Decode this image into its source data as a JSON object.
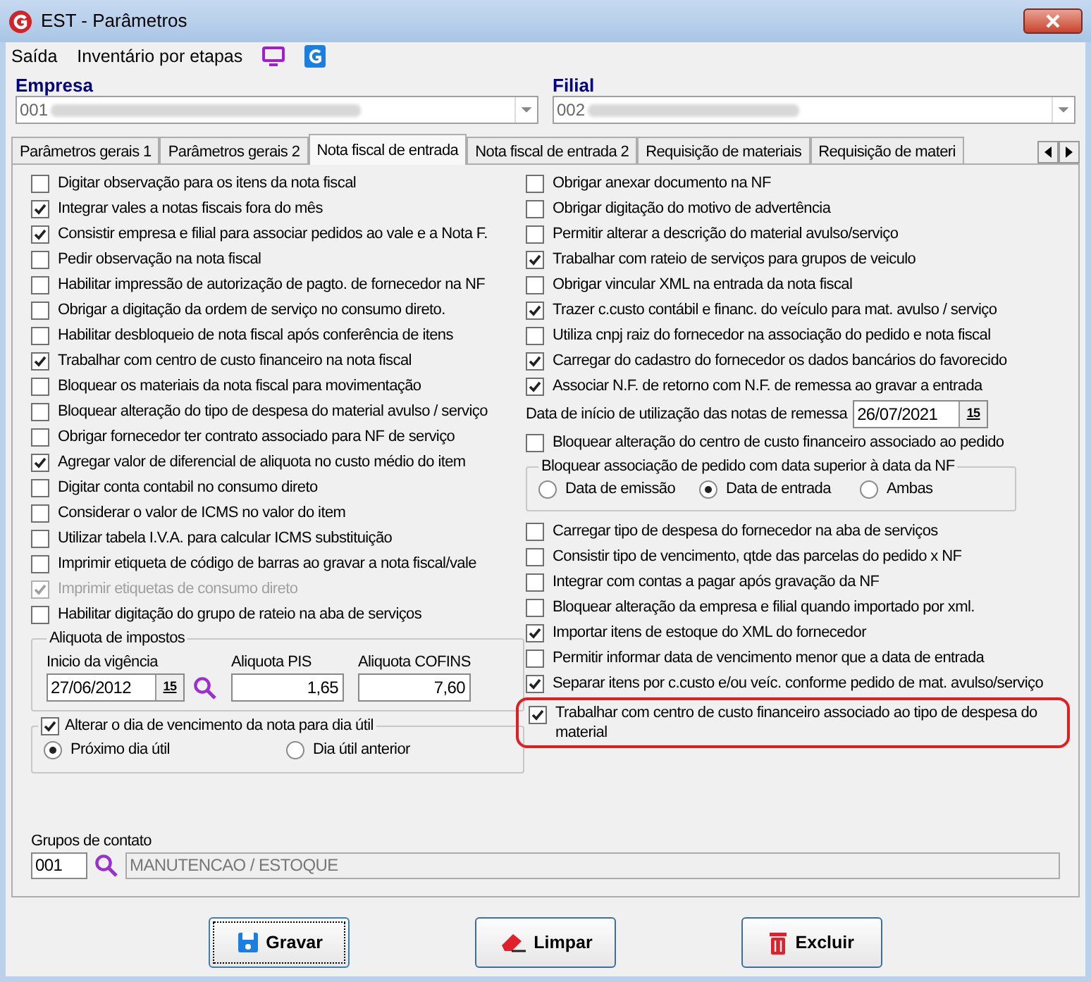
{
  "window": {
    "title": "EST - Parâmetros"
  },
  "menu": [
    "Saída",
    "Inventário por etapas"
  ],
  "empresa": {
    "label": "Empresa",
    "value": "001"
  },
  "filial": {
    "label": "Filial",
    "value": "002"
  },
  "tabs": [
    {
      "label": "Parâmetros gerais 1",
      "selected": false
    },
    {
      "label": "Parâmetros gerais 2",
      "selected": false
    },
    {
      "label": "Nota fiscal de entrada",
      "selected": true
    },
    {
      "label": "Nota fiscal de entrada 2",
      "selected": false
    },
    {
      "label": "Requisição de materiais",
      "selected": false
    },
    {
      "label": "Requisição de materi",
      "selected": false
    }
  ],
  "left_options": [
    {
      "label": "Digitar observação para os itens da nota fiscal",
      "checked": false,
      "disabled": false
    },
    {
      "label": "Integrar vales a notas fiscais fora do mês",
      "checked": true,
      "disabled": false
    },
    {
      "label": "Consistir empresa e filial para associar pedidos ao vale e a Nota F.",
      "checked": true,
      "disabled": false
    },
    {
      "label": "Pedir observação na nota fiscal",
      "checked": false,
      "disabled": false
    },
    {
      "label": "Habilitar impressão de autorização de pagto. de fornecedor na NF",
      "checked": false,
      "disabled": false
    },
    {
      "label": "Obrigar a digitação da ordem de serviço no consumo direto.",
      "checked": false,
      "disabled": false
    },
    {
      "label": "Habilitar desbloqueio de nota fiscal após conferência de itens",
      "checked": false,
      "disabled": false
    },
    {
      "label": "Trabalhar com centro de custo financeiro na nota fiscal",
      "checked": true,
      "disabled": false
    },
    {
      "label": "Bloquear os materiais da nota fiscal para movimentação",
      "checked": false,
      "disabled": false
    },
    {
      "label": "Bloquear alteração do tipo de despesa do material avulso / serviço",
      "checked": false,
      "disabled": false
    },
    {
      "label": "Obrigar fornecedor ter contrato associado para NF de serviço",
      "checked": false,
      "disabled": false
    },
    {
      "label": "Agregar valor de diferencial de aliquota no custo médio do item",
      "checked": true,
      "disabled": false
    },
    {
      "label": "Digitar conta contabil no consumo direto",
      "checked": false,
      "disabled": false
    },
    {
      "label": "Considerar o valor de ICMS no valor do item",
      "checked": false,
      "disabled": false
    },
    {
      "label": "Utilizar tabela I.V.A. para calcular ICMS substituição",
      "checked": false,
      "disabled": false
    },
    {
      "label": "Imprimir etiqueta de código de barras ao gravar a nota fiscal/vale",
      "checked": false,
      "disabled": false
    },
    {
      "label": "Imprimir etiquetas de consumo direto",
      "checked": true,
      "disabled": true
    },
    {
      "label": "Habilitar digitação do grupo de rateio na aba de serviços",
      "checked": false,
      "disabled": false
    }
  ],
  "aliquota": {
    "title": "Aliquota de impostos",
    "inicio_label": "Inicio da vigência",
    "inicio_value": "27/06/2012",
    "calendar": "15",
    "pis_label": "Aliquota PIS",
    "pis_value": "1,65",
    "cofins_label": "Aliquota COFINS",
    "cofins_value": "7,60"
  },
  "vencimento": {
    "label": "Alterar o dia de vencimento da nota para dia útil",
    "checked": true,
    "options": [
      {
        "label": "Próximo dia útil",
        "selected": true
      },
      {
        "label": "Dia útil anterior",
        "selected": false
      }
    ]
  },
  "grupos_contato": {
    "label": "Grupos de contato",
    "code": "001",
    "description": "MANUTENCAO / ESTOQUE"
  },
  "right_options": [
    {
      "kind": "checkbox",
      "label": "Obrigar anexar documento na NF",
      "checked": false,
      "highlighted": false
    },
    {
      "kind": "checkbox",
      "label": "Obrigar digitação do motivo de advertência",
      "checked": false,
      "highlighted": false
    },
    {
      "kind": "checkbox",
      "label": "Permitir alterar a descrição do material avulso/serviço",
      "checked": false,
      "highlighted": false
    },
    {
      "kind": "checkbox",
      "label": "Trabalhar com rateio de serviços para grupos de veiculo",
      "checked": true,
      "highlighted": false
    },
    {
      "kind": "checkbox",
      "label": "Obrigar vincular XML na entrada da nota fiscal",
      "checked": false,
      "highlighted": false
    },
    {
      "kind": "checkbox",
      "label": "Trazer c.custo contábil e financ. do veículo para mat. avulso / serviço",
      "checked": true,
      "highlighted": false
    },
    {
      "kind": "checkbox",
      "label": "Utiliza cnpj raiz do fornecedor na associação do pedido e nota fiscal",
      "checked": false,
      "highlighted": false
    },
    {
      "kind": "checkbox",
      "label": "Carregar do cadastro do fornecedor os dados bancários do favorecido",
      "checked": true,
      "highlighted": false
    },
    {
      "kind": "checkbox",
      "label": "Associar N.F. de retorno com N.F. de remessa ao gravar a entrada",
      "checked": true,
      "highlighted": false
    },
    {
      "kind": "date",
      "label": "Data de início de utilização das notas de remessa",
      "value": "26/07/2021",
      "calendar": "15"
    },
    {
      "kind": "checkbox",
      "label": "Bloquear alteração do centro de custo financeiro associado ao pedido",
      "checked": false,
      "highlighted": false
    },
    {
      "kind": "radio_group",
      "title": "Bloquear associação de pedido com data superior à data da NF",
      "options": [
        {
          "label": "Data de emissão",
          "selected": false
        },
        {
          "label": "Data de entrada",
          "selected": true
        },
        {
          "label": "Ambas",
          "selected": false
        }
      ]
    },
    {
      "kind": "checkbox",
      "label": "Carregar tipo de despesa do fornecedor na aba de serviços",
      "checked": false,
      "highlighted": false
    },
    {
      "kind": "checkbox",
      "label": "Consistir tipo de vencimento, qtde das parcelas do pedido x NF",
      "checked": false,
      "highlighted": false
    },
    {
      "kind": "checkbox",
      "label": "Integrar com contas a pagar após gravação da NF",
      "checked": false,
      "highlighted": false
    },
    {
      "kind": "checkbox",
      "label": "Bloquear alteração da empresa e filial quando importado por xml.",
      "checked": false,
      "highlighted": false
    },
    {
      "kind": "checkbox",
      "label": "Importar itens de estoque do XML do fornecedor",
      "checked": true,
      "highlighted": false
    },
    {
      "kind": "checkbox",
      "label": "Permitir informar data de vencimento menor que a data de entrada",
      "checked": false,
      "highlighted": false
    },
    {
      "kind": "checkbox",
      "label": "Separar itens por c.custo e/ou veíc. conforme pedido de mat. avulso/serviço",
      "checked": true,
      "highlighted": false
    },
    {
      "kind": "checkbox",
      "label": "Trabalhar com centro de custo financeiro associado ao tipo de despesa do material",
      "checked": true,
      "highlighted": true
    }
  ],
  "buttons": [
    {
      "kind": "save",
      "label": "Gravar",
      "selected": true
    },
    {
      "kind": "clear",
      "label": "Limpar",
      "selected": false
    },
    {
      "kind": "delete",
      "label": "Excluir",
      "selected": false
    }
  ]
}
